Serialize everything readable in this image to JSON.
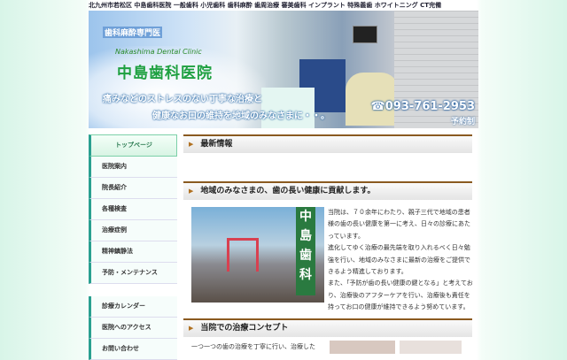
{
  "header": {
    "keywords": "北九州市若松区 中島歯科医院 一般歯科 小児歯科 歯科麻酔 歯周治療 審美歯科 インプラント 特殊義歯 ホワイトニング CT完備"
  },
  "banner": {
    "specialty": "歯科麻酔専門医",
    "name_en": "Nakashima Dental Clinic",
    "name": "中島歯科医院",
    "tagline1": "痛みなどのストレスのない丁寧な治療と",
    "tagline2": "健康なお口の維持を地域のみなさまに・・。",
    "phone": "☎093-761-2953",
    "reservation": "予約制"
  },
  "nav": {
    "main": [
      "トップページ",
      "医院案内",
      "院長紹介",
      "各種検査",
      "治療症例",
      "精神鎮静法",
      "予防・メンテナンス"
    ],
    "sub": [
      "診療カレンダー",
      "医院へのアクセス",
      "お問い合わせ"
    ]
  },
  "sections": {
    "news": "最新情報",
    "contribution": "地域のみなさまの、歯の長い健康に貢献します。",
    "concept": "当院での治療コンセプト"
  },
  "photo_sign": "中島歯科",
  "body": {
    "intro": "当院は、７０余年にわたり、親子三代で地域の患者様の歯の長い健康を第一に考え、日々の診療にあたっています。",
    "p2": "進化してゆく治療の最先端を取り入れるべく日々勉強を行い、地域のみなさまに最新の治療をご提供できるよう精進しております。",
    "p3": "また、「予防が歯の長い健康の鍵となる」と考えており、治療後のアフターケアを行い、治療後も責任を持ってお口の健康が維持できるよう努めています。",
    "concept_text": "一つ一つの歯の治療を丁寧に行い、治療した"
  }
}
